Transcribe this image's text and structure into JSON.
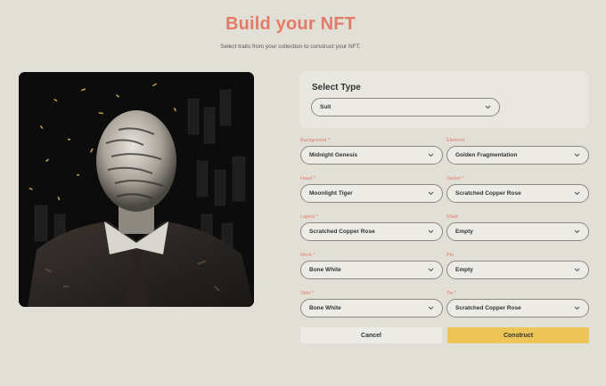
{
  "header": {
    "title": "Build your NFT",
    "subtitle": "Select traits from your collection to construct your NFT."
  },
  "select_type": {
    "label": "Select Type",
    "value": "Suit"
  },
  "traits": [
    {
      "label": "Background",
      "required": "*",
      "value": "Midnight Genesis"
    },
    {
      "label": "Element",
      "required": "",
      "value": "Golden Fragmentation"
    },
    {
      "label": "Head",
      "required": "*",
      "value": "Moonlight Tiger"
    },
    {
      "label": "Jacket",
      "required": "*",
      "value": "Scratched Copper Rose"
    },
    {
      "label": "Lapels",
      "required": "*",
      "value": "Scratched Copper Rose"
    },
    {
      "label": "Mask",
      "required": "",
      "value": "Empty"
    },
    {
      "label": "Neck",
      "required": "*",
      "value": "Bone White"
    },
    {
      "label": "Pin",
      "required": "",
      "value": "Empty"
    },
    {
      "label": "Shirt",
      "required": "*",
      "value": "Bone White"
    },
    {
      "label": "Tie",
      "required": "*",
      "value": "Scratched Copper Rose"
    }
  ],
  "actions": {
    "cancel": "Cancel",
    "construct": "Construct"
  },
  "colors": {
    "accent": "#e37b68",
    "construct_button": "#ecc458",
    "background": "#e2e0d6"
  },
  "icons": {
    "dropdown": "chevron-down-icon"
  }
}
